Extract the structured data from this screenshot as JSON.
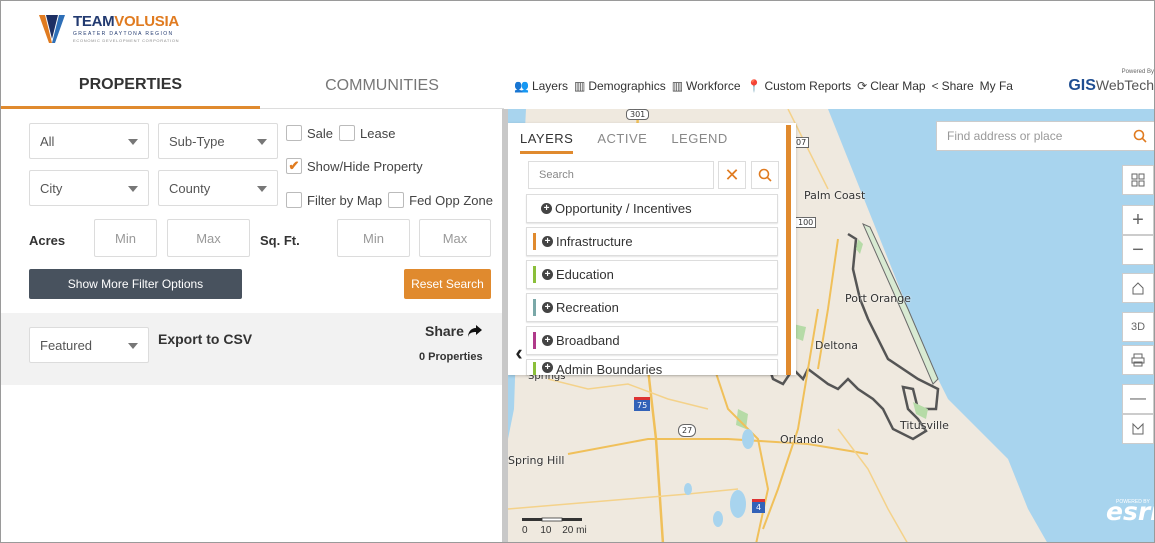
{
  "brand": {
    "title_main": "TEAM",
    "title_accent": "VOLUSIA",
    "subtitle": "GREATER DAYTONA REGION",
    "subtitle2": "ECONOMIC DEVELOPMENT CORPORATION"
  },
  "left_tabs": {
    "properties": "PROPERTIES",
    "communities": "COMMUNITIES"
  },
  "filters": {
    "type_value": "All",
    "subtype_value": "Sub-Type",
    "city_value": "City",
    "county_value": "County",
    "sale_label": "Sale",
    "lease_label": "Lease",
    "show_hide_label": "Show/Hide Property",
    "filter_map_label": "Filter by Map",
    "fed_opp_label": "Fed Opp Zone",
    "acres_label": "Acres",
    "sqft_label": "Sq. Ft.",
    "acres_min_placeholder": "Min",
    "acres_max_placeholder": "Max",
    "sqft_min_placeholder": "Min",
    "sqft_max_placeholder": "Max",
    "more_button": "Show More Filter Options",
    "reset_button": "Reset Search"
  },
  "results": {
    "sort_value": "Featured",
    "export_label": "Export to CSV",
    "share_label": "Share",
    "count_label": "0 Properties"
  },
  "toolbar": {
    "layers": "Layers",
    "demographics": "Demographics",
    "workforce": "Workforce",
    "custom_reports": "Custom Reports",
    "clear_map": "Clear Map",
    "share": "Share",
    "my_fa": "My Fa",
    "gis_powered": "Powered By",
    "gis_name": "GIS",
    "gis_webtech": "WebTech"
  },
  "map": {
    "find_placeholder": "Find address or place",
    "labels": {
      "palm_coast": "Palm Coast",
      "port_orange": "Port Orange",
      "deltona": "Deltona",
      "orlando": "Orlando",
      "titusville": "Titusville",
      "spring_hill": "Spring Hill",
      "springs": "Springs",
      "route_301": "301",
      "route_100": "100",
      "route_107": "07",
      "route_27": "27",
      "route_75": "75",
      "route_4": "4"
    },
    "controls": {
      "threed": "3D"
    },
    "scale": {
      "t0": "0",
      "t1": "10",
      "t2": "20 mi"
    },
    "esri_powered": "POWERED BY",
    "esri": "esri"
  },
  "layers_panel": {
    "tab_layers": "LAYERS",
    "tab_active": "ACTIVE",
    "tab_legend": "LEGEND",
    "search_placeholder": "Search",
    "items": [
      {
        "label": "Opportunity / Incentives",
        "color": ""
      },
      {
        "label": "Infrastructure",
        "color": "#e08a2e"
      },
      {
        "label": "Education",
        "color": "#8bbf3a"
      },
      {
        "label": "Recreation",
        "color": "#7aa8a8"
      },
      {
        "label": "Broadband",
        "color": "#b03a8a"
      },
      {
        "label": "Admin Boundaries",
        "color": "#8bbf3a"
      }
    ]
  },
  "colors": {
    "accent": "#e08a2e",
    "dark_button": "#48525e",
    "ocean": "#a8d4ee",
    "land": "#efe9df"
  }
}
